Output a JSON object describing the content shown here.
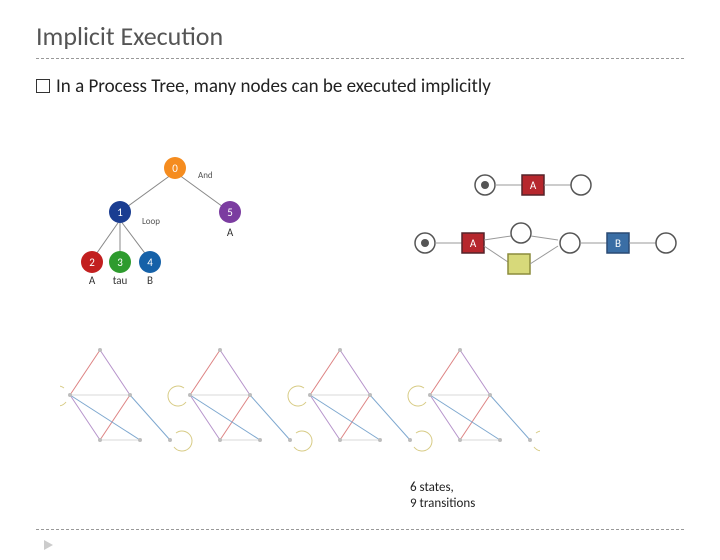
{
  "title": "Implicit Execution",
  "bullet_text": "In a Process Tree, many nodes can be executed implicitly",
  "tree": {
    "nodes": [
      {
        "id": 0,
        "label": "0",
        "sub": "And",
        "color": "#f58c1f"
      },
      {
        "id": 1,
        "label": "1",
        "sub": "Loop",
        "color": "#1a3d91"
      },
      {
        "id": 5,
        "label": "5",
        "sub": "A",
        "color": "#7b3ca0"
      },
      {
        "id": 2,
        "label": "2",
        "sub": "A",
        "color": "#c21f1f"
      },
      {
        "id": 3,
        "label": "3",
        "sub": "tau",
        "color": "#2e9b2e"
      },
      {
        "id": 4,
        "label": "4",
        "sub": "B",
        "color": "#1561a8"
      }
    ],
    "edges": [
      [
        0,
        1
      ],
      [
        0,
        5
      ],
      [
        1,
        2
      ],
      [
        1,
        3
      ],
      [
        1,
        4
      ]
    ]
  },
  "petri": {
    "row1": {
      "label": "A"
    },
    "row2": {
      "labelA": "A",
      "labelB": "B"
    }
  },
  "caption": {
    "line1": "6 states,",
    "line2": "9 transitions"
  }
}
